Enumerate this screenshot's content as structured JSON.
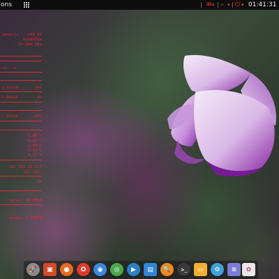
{
  "topbar": {
    "left_label": "ons",
    "clock": "01:41:31 PM",
    "colors": {
      "indicator": "#ff3b30",
      "bar": "#0d0d0d"
    }
  },
  "conky": {
    "kernel": "x86_64",
    "kernel_suffix": "-generic",
    "user": "mohamida",
    "uptime": "0h 40m 50s",
    "swap1": "1.92GiB",
    "swap1_pct": "34%",
    "swap2": "1.96GiB",
    "swap2_pct": "0%",
    "disk": "/ 15GiB",
    "disk_pct": "43%",
    "load": [
      "1.48 %",
      "0.85 %",
      "1.48 %",
      "1.31 %",
      "4.17 %"
    ],
    "ip_public": "197.181.85.117",
    "ip_local": "197.181.",
    "pct_line": "1%",
    "net_total_down": "total: 46.3MiB",
    "net_total_up": "total: 1.15MiB"
  },
  "dock": {
    "apps": [
      {
        "name": "launcher-icon",
        "glyph": "🚀",
        "color": "#8a8a8a"
      },
      {
        "name": "software-center-icon",
        "glyph": "▣",
        "color": "#d24b2a"
      },
      {
        "name": "firefox-icon",
        "glyph": "●",
        "color": "#e86a1f"
      },
      {
        "name": "opera-icon",
        "glyph": "O",
        "color": "#e23b2b"
      },
      {
        "name": "globe-icon",
        "glyph": "◉",
        "color": "#3d88d8"
      },
      {
        "name": "browser-icon",
        "glyph": "◎",
        "color": "#4aa64a"
      },
      {
        "name": "media-player-icon",
        "glyph": "▶",
        "color": "#2d7fc2"
      },
      {
        "name": "window-icon",
        "glyph": "▤",
        "color": "#2f86d6"
      },
      {
        "name": "search-icon",
        "glyph": "🔍",
        "color": "#f08a1e"
      },
      {
        "name": "terminal-icon",
        "glyph": ">_",
        "color": "#3a3a3a"
      },
      {
        "name": "files-icon",
        "glyph": "▭",
        "color": "#f0b133"
      },
      {
        "name": "settings-icon",
        "glyph": "⚙",
        "color": "#3fa1d6"
      },
      {
        "name": "document-icon",
        "glyph": "≡",
        "color": "#7b7bd6"
      },
      {
        "name": "image-viewer-icon",
        "glyph": "✿",
        "color": "#e8e8e8"
      }
    ]
  }
}
